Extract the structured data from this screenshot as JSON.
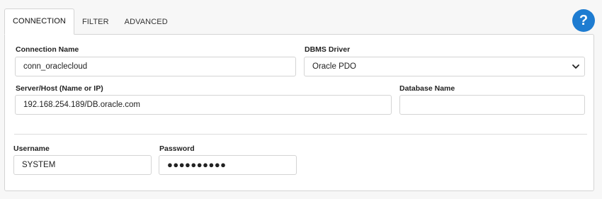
{
  "tabs": [
    {
      "label": "CONNECTION",
      "active": true
    },
    {
      "label": "FILTER",
      "active": false
    },
    {
      "label": "ADVANCED",
      "active": false
    }
  ],
  "help": {
    "label": "?",
    "color": "#1e7cd1"
  },
  "form": {
    "connection_name": {
      "label": "Connection Name",
      "value": "conn_oraclecloud"
    },
    "dbms_driver": {
      "label": "DBMS Driver",
      "value": "Oracle PDO"
    },
    "server_host": {
      "label": "Server/Host (Name or IP)",
      "value": "192.168.254.189/DB.oracle.com"
    },
    "database_name": {
      "label": "Database Name",
      "value": ""
    },
    "username": {
      "label": "Username",
      "value": "SYSTEM"
    },
    "password": {
      "label": "Password",
      "value": "●●●●●●●●●●"
    }
  }
}
